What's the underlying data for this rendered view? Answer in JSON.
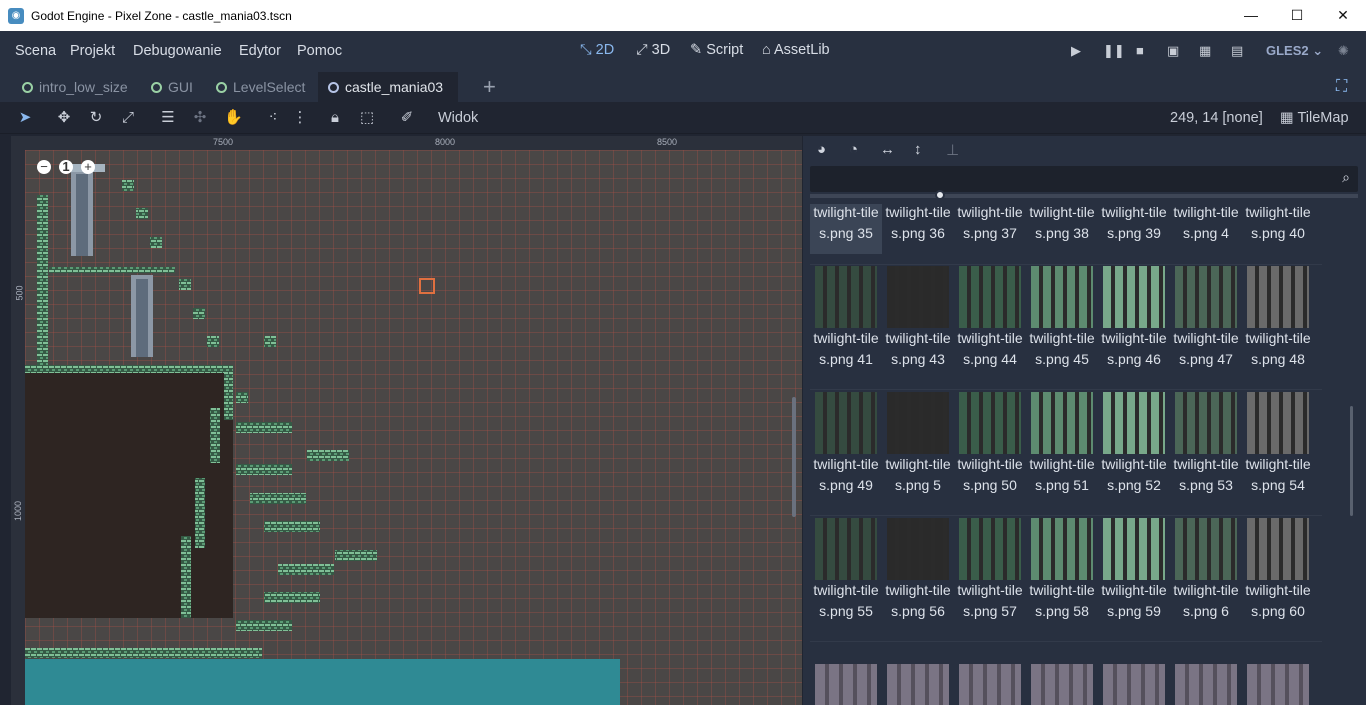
{
  "window": {
    "title": "Godot Engine - Pixel Zone - castle_mania03.tscn",
    "minimize": "—",
    "maximize": "☐",
    "close": "✕"
  },
  "menu": [
    "Scena",
    "Projekt",
    "Debugowanie",
    "Edytor",
    "Pomoc"
  ],
  "workspaces": [
    {
      "label": "2D",
      "icon": "2d-icon",
      "active": true
    },
    {
      "label": "3D",
      "icon": "3d-icon",
      "active": false
    },
    {
      "label": "Script",
      "icon": "script-icon",
      "active": false
    },
    {
      "label": "AssetLib",
      "icon": "assetlib-icon",
      "active": false
    }
  ],
  "renderer": "GLES2",
  "tabs": [
    {
      "label": "intro_low_size",
      "active": false
    },
    {
      "label": "GUI",
      "active": false
    },
    {
      "label": "LevelSelect",
      "active": false
    },
    {
      "label": "castle_mania03",
      "active": true
    }
  ],
  "toolbar": {
    "view_label": "Widok",
    "coords": "249, 14 [none]",
    "node_label": "TileMap"
  },
  "ruler": {
    "top": [
      "7500",
      "8000",
      "8500"
    ],
    "left": [
      "500",
      "1000"
    ]
  },
  "zoom": {
    "level": "1"
  },
  "tiles": [
    {
      "label": "twilight-tiles.png 35",
      "selected": true
    },
    {
      "label": "twilight-tiles.png 36"
    },
    {
      "label": "twilight-tiles.png 37"
    },
    {
      "label": "twilight-tiles.png 38"
    },
    {
      "label": "twilight-tiles.png 39"
    },
    {
      "label": "twilight-tiles.png 4"
    },
    {
      "label": "twilight-tiles.png 40"
    },
    {
      "label": "twilight-tiles.png 41"
    },
    {
      "label": "twilight-tiles.png 43"
    },
    {
      "label": "twilight-tiles.png 44"
    },
    {
      "label": "twilight-tiles.png 45"
    },
    {
      "label": "twilight-tiles.png 46"
    },
    {
      "label": "twilight-tiles.png 47"
    },
    {
      "label": "twilight-tiles.png 48"
    },
    {
      "label": "twilight-tiles.png 49"
    },
    {
      "label": "twilight-tiles.png 5"
    },
    {
      "label": "twilight-tiles.png 50"
    },
    {
      "label": "twilight-tiles.png 51"
    },
    {
      "label": "twilight-tiles.png 52"
    },
    {
      "label": "twilight-tiles.png 53"
    },
    {
      "label": "twilight-tiles.png 54"
    },
    {
      "label": "twilight-tiles.png 55"
    },
    {
      "label": "twilight-tiles.png 56"
    },
    {
      "label": "twilight-tiles.png 57"
    },
    {
      "label": "twilight-tiles.png 58"
    },
    {
      "label": "twilight-tiles.png 59"
    },
    {
      "label": "twilight-tiles.png 6"
    },
    {
      "label": "twilight-tiles.png 60"
    }
  ],
  "colors": {
    "accent": "#8ab8ee",
    "panel": "#283040",
    "tile_green": "#5f9c7a",
    "water": "#2f8a94"
  }
}
